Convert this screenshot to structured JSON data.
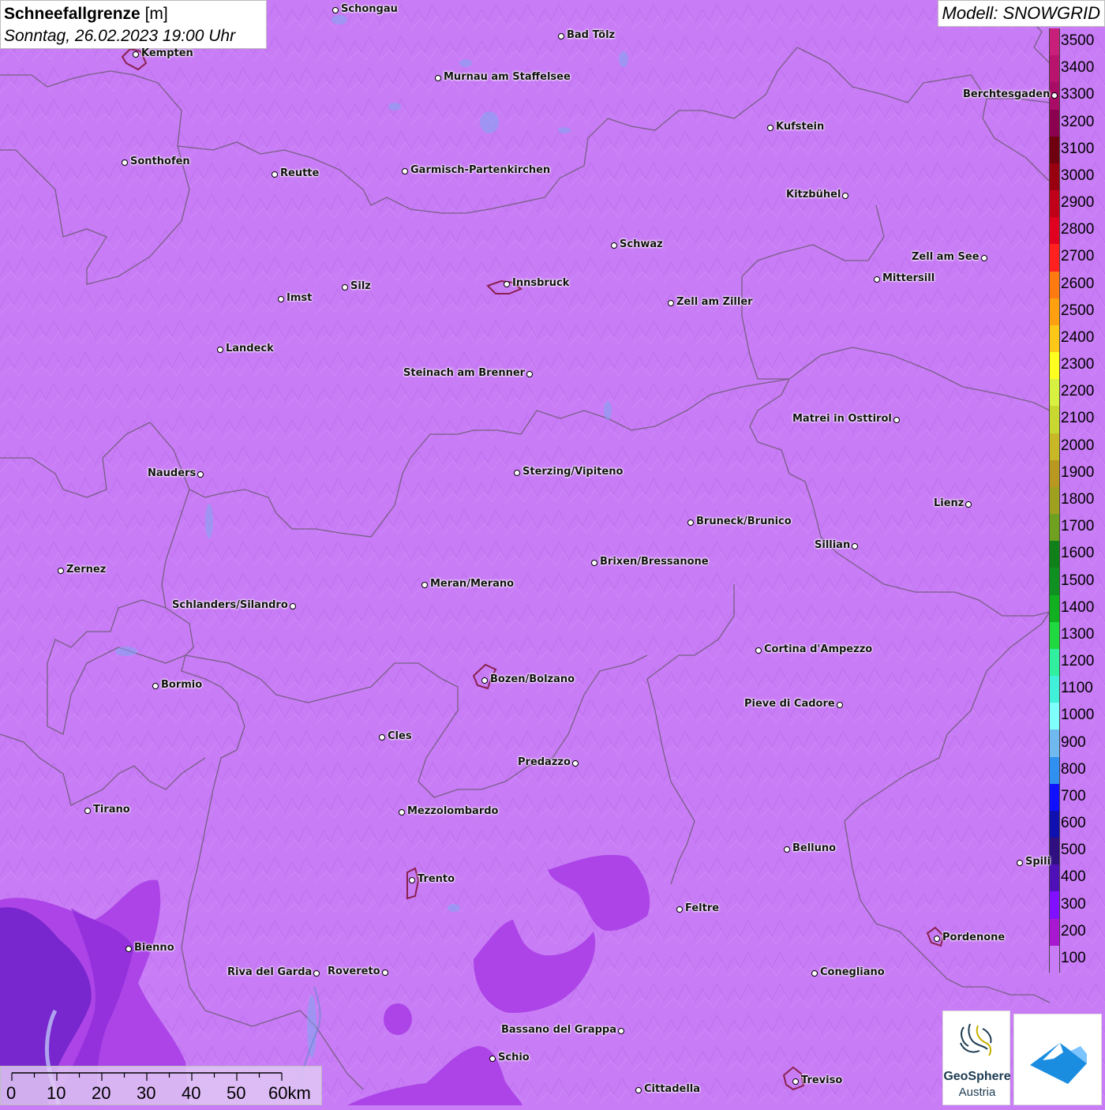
{
  "title": {
    "bold": "Schneefallgrenze",
    "unit": " [m]",
    "subtitle": "Sonntag, 26.02.2023 19:00 Uhr"
  },
  "model": "Modell: SNOWGRID",
  "legend": {
    "labels": [
      "3500",
      "3400",
      "3300",
      "3200",
      "3100",
      "3000",
      "2900",
      "2800",
      "2700",
      "2600",
      "2500",
      "2400",
      "2300",
      "2200",
      "2100",
      "2000",
      "1900",
      "1800",
      "1700",
      "1600",
      "1500",
      "1400",
      "1300",
      "1200",
      "1100",
      "1000",
      "900",
      "800",
      "700",
      "600",
      "500",
      "400",
      "300",
      "200",
      "100"
    ],
    "colors": [
      "#c8207a",
      "#b8146e",
      "#a80c66",
      "#8c0050",
      "#6e0010",
      "#980010",
      "#c00018",
      "#e00020",
      "#ff2020",
      "#ff7a10",
      "#ffa010",
      "#ffc818",
      "#ffff20",
      "#d8f040",
      "#c8d830",
      "#c8b828",
      "#b89820",
      "#a0a020",
      "#70a020",
      "#108018",
      "#109020",
      "#10b020",
      "#20d840",
      "#30f0a0",
      "#40f0d8",
      "#80ffff",
      "#70b8f0",
      "#3090f0",
      "#1010ff",
      "#1010b0",
      "#301080",
      "#5010b8",
      "#8010ff",
      "#a818d0",
      "#c87cf5"
    ]
  },
  "cities": [
    {
      "name": "Schongau",
      "side": "right"
    },
    {
      "name": "Bad Tölz",
      "side": "right"
    },
    {
      "name": "Kempten",
      "side": "right"
    },
    {
      "name": "Murnau am Staffelsee",
      "side": "right"
    },
    {
      "name": "Berchtesgaden",
      "side": "left"
    },
    {
      "name": "Kufstein",
      "side": "right"
    },
    {
      "name": "Sonthofen",
      "side": "right"
    },
    {
      "name": "Reutte",
      "side": "right"
    },
    {
      "name": "Garmisch-Partenkirchen",
      "side": "right"
    },
    {
      "name": "Kitzbühel",
      "side": "left"
    },
    {
      "name": "Schwaz",
      "side": "right"
    },
    {
      "name": "Zell am See",
      "side": "left"
    },
    {
      "name": "Innsbruck",
      "side": "right"
    },
    {
      "name": "Mittersill",
      "side": "right"
    },
    {
      "name": "Imst",
      "side": "right"
    },
    {
      "name": "Silz",
      "side": "right"
    },
    {
      "name": "Zell am Ziller",
      "side": "right"
    },
    {
      "name": "Landeck",
      "side": "right"
    },
    {
      "name": "Steinach am Brenner",
      "side": "left"
    },
    {
      "name": "Matrei in Osttirol",
      "side": "left"
    },
    {
      "name": "Nauders",
      "side": "left"
    },
    {
      "name": "Sterzing/Vipiteno",
      "side": "right"
    },
    {
      "name": "Lienz",
      "side": "left"
    },
    {
      "name": "Bruneck/Brunico",
      "side": "right"
    },
    {
      "name": "Sillian",
      "side": "left"
    },
    {
      "name": "Zernez",
      "side": "right"
    },
    {
      "name": "Brixen/Bressanone",
      "side": "right"
    },
    {
      "name": "Meran/Merano",
      "side": "right"
    },
    {
      "name": "Schlanders/Silandro",
      "side": "left"
    },
    {
      "name": "Cortina d'Ampezzo",
      "side": "right"
    },
    {
      "name": "Bozen/Bolzano",
      "side": "right"
    },
    {
      "name": "Bormio",
      "side": "right"
    },
    {
      "name": "Pieve di Cadore",
      "side": "left"
    },
    {
      "name": "Cles",
      "side": "right"
    },
    {
      "name": "Predazzo",
      "side": "left"
    },
    {
      "name": "Tirano",
      "side": "right"
    },
    {
      "name": "Mezzolombardo",
      "side": "right"
    },
    {
      "name": "Belluno",
      "side": "right"
    },
    {
      "name": "Spili",
      "side": "right"
    },
    {
      "name": "Trento",
      "side": "right"
    },
    {
      "name": "Feltre",
      "side": "right"
    },
    {
      "name": "Pordenone",
      "side": "right"
    },
    {
      "name": "Bienno",
      "side": "right"
    },
    {
      "name": "Riva del Garda",
      "side": "left"
    },
    {
      "name": "Rovereto",
      "side": "left"
    },
    {
      "name": "Conegliano",
      "side": "right"
    },
    {
      "name": "Bassano del Grappa",
      "side": "left"
    },
    {
      "name": "Schio",
      "side": "right"
    },
    {
      "name": "Treviso",
      "side": "right"
    },
    {
      "name": "Cittadella",
      "side": "right"
    }
  ],
  "scale": {
    "labels": [
      "0",
      "10",
      "20",
      "30",
      "40",
      "50",
      "60km"
    ]
  },
  "logos": {
    "geosphere_line1": "GeoSphere",
    "geosphere_line2": "Austria"
  }
}
